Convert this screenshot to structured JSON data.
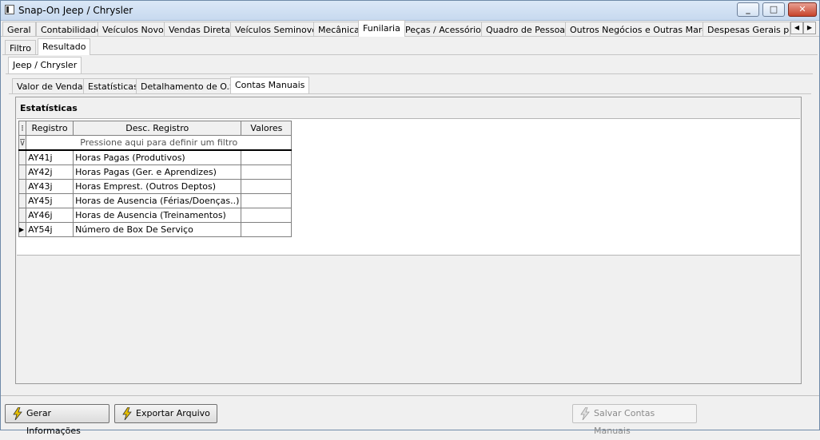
{
  "window": {
    "title": "Snap-On Jeep / Chrysler"
  },
  "main_tabs": [
    "Geral",
    "Contabilidade",
    "Veículos Novos",
    "Vendas Diretas",
    "Veículos Seminovos",
    "Mecânica",
    "Funilaria",
    "Peças / Acessórios",
    "Quadro de Pessoas",
    "Outros Negócios e Outras Marcas",
    "Despesas Gerais por D"
  ],
  "main_tabs_active": "Funilaria",
  "sub_tabs": [
    "Filtro",
    "Resultado"
  ],
  "brand_tab": "Jeep / Chrysler",
  "report_tabs": [
    "Valor de Vendas",
    "Estatísticas",
    "Detalhamento de O.S.",
    "Contas Manuais"
  ],
  "group_title": "Estatísticas",
  "grid": {
    "columns": [
      "Registro",
      "Desc. Registro",
      "Valores"
    ],
    "filter_placeholder": "Pressione aqui para definir um filtro",
    "rows": [
      {
        "registro": "AY41j",
        "desc": "Horas Pagas (Produtivos)",
        "valor": ""
      },
      {
        "registro": "AY42j",
        "desc": "Horas Pagas (Ger. e Aprendizes)",
        "valor": ""
      },
      {
        "registro": "AY43j",
        "desc": "Horas Emprest. (Outros Deptos)",
        "valor": ""
      },
      {
        "registro": "AY45j",
        "desc": "Horas de Ausencia (Férias/Doenças..)",
        "valor": ""
      },
      {
        "registro": "AY46j",
        "desc": "Horas de Ausencia (Treinamentos)",
        "valor": ""
      },
      {
        "registro": "AY54j",
        "desc": "Número de Box De Serviço",
        "valor": ""
      }
    ]
  },
  "buttons": {
    "gerar": "Gerar Informações",
    "exportar": "Exportar Arquivo",
    "salvar": "Salvar Contas Manuais"
  },
  "colors": {
    "title_bar": "#c7d9ef",
    "close_button": "#c7432b",
    "bolt_icon": "#e8c000"
  }
}
